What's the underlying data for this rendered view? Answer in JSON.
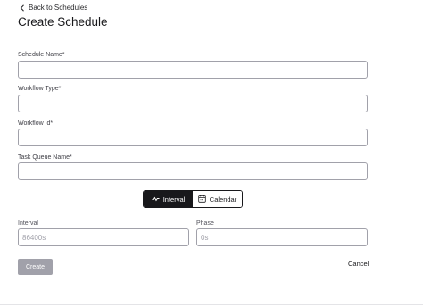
{
  "back_link": {
    "label": "Back to Schedules"
  },
  "page_title": "Create Schedule",
  "form": {
    "schedule_name": {
      "label": "Schedule Name*",
      "value": ""
    },
    "workflow_type": {
      "label": "Workflow Type*",
      "value": ""
    },
    "workflow_id": {
      "label": "Workflow Id*",
      "value": ""
    },
    "task_queue_name": {
      "label": "Task Queue Name*",
      "value": ""
    }
  },
  "mode_toggle": {
    "interval_label": "Interval",
    "calendar_label": "Calendar",
    "selected": "Interval"
  },
  "interval": {
    "label": "Interval",
    "placeholder": "86400s",
    "value": ""
  },
  "phase": {
    "label": "Phase",
    "placeholder": "0s",
    "value": ""
  },
  "actions": {
    "create_label": "Create",
    "cancel_label": "Cancel"
  },
  "colors": {
    "primary": "#18181b",
    "disabled_button": "#a1a1aa",
    "input_border": "#a1a1aa"
  },
  "icons": {
    "back": "chevron-left-icon",
    "interval": "pulse-wave-icon",
    "calendar": "calendar-icon"
  }
}
